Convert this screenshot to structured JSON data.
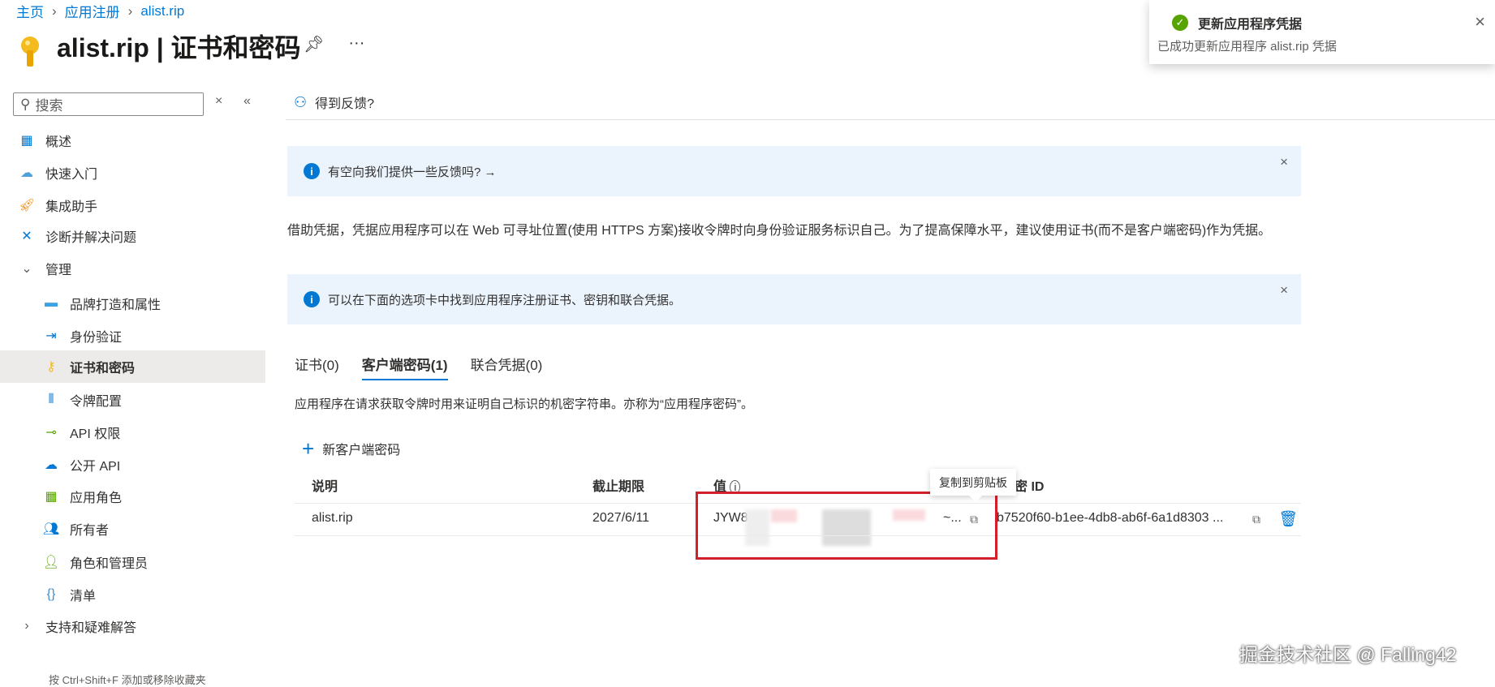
{
  "breadcrumb": [
    "主页",
    "应用注册",
    "alist.rip"
  ],
  "page_title": "alist.rip | 证书和密码",
  "more": "···",
  "search": {
    "placeholder": "搜索"
  },
  "feedback": "得到反馈?",
  "sidebar": {
    "items": [
      {
        "label": "概述",
        "icon": "overview-icon"
      },
      {
        "label": "快速入门",
        "icon": "quickstart-icon"
      },
      {
        "label": "集成助手",
        "icon": "rocket-icon"
      },
      {
        "label": "诊断并解决问题",
        "icon": "wrench-icon"
      },
      {
        "label": "管理",
        "icon": "chevron-down-icon"
      },
      {
        "label": "品牌打造和属性",
        "icon": "branding-icon"
      },
      {
        "label": "身份验证",
        "icon": "auth-icon"
      },
      {
        "label": "证书和密码",
        "icon": "key-icon"
      },
      {
        "label": "令牌配置",
        "icon": "token-icon"
      },
      {
        "label": "API 权限",
        "icon": "api-permission-icon"
      },
      {
        "label": "公开 API",
        "icon": "cloud-icon"
      },
      {
        "label": "应用角色",
        "icon": "app-roles-icon"
      },
      {
        "label": "所有者",
        "icon": "owners-icon"
      },
      {
        "label": "角色和管理员",
        "icon": "roles-admin-icon"
      },
      {
        "label": "清单",
        "icon": "manifest-icon"
      },
      {
        "label": "支持和疑难解答",
        "icon": "chevron-right-icon"
      }
    ],
    "footer_hint": "按 Ctrl+Shift+F 添加或移除收藏夹"
  },
  "info1": "有空向我们提供一些反馈吗? →",
  "paragraph": "借助凭据，凭据应用程序可以在 Web 可寻址位置(使用 HTTPS 方案)接收令牌时向身份验证服务标识自己。为了提高保障水平，建议使用证书(而不是客户端密码)作为凭据。",
  "info2": "可以在下面的选项卡中找到应用程序注册证书、密钥和联合凭据。",
  "tabs": [
    "证书(0)",
    "客户端密码(1)",
    "联合凭据(0)"
  ],
  "tab_desc": "应用程序在请求获取令牌时用来证明自己标识的机密字符串。亦称为“应用程序密码”。",
  "new_secret": "新客户端密码",
  "table": {
    "headers": [
      "说明",
      "截止期限",
      "值",
      "密 ID"
    ],
    "rows": [
      {
        "desc": "alist.rip",
        "expires": "2027/6/11",
        "value_prefix": "JYW8",
        "value_suffix": "~...",
        "secret_id": "b7520f60-b1ee-4db8-ab6f-6a1d8303 ..."
      }
    ]
  },
  "tooltip": "复制到剪贴板",
  "toast": {
    "title": "更新应用程序凭据",
    "message": "已成功更新应用程序 alist.rip 凭据"
  },
  "watermark": "掘金技术社区 @ Falling42",
  "colors": {
    "accent": "#0078d4",
    "success": "#57a300",
    "highlight": "#d11f2b"
  }
}
